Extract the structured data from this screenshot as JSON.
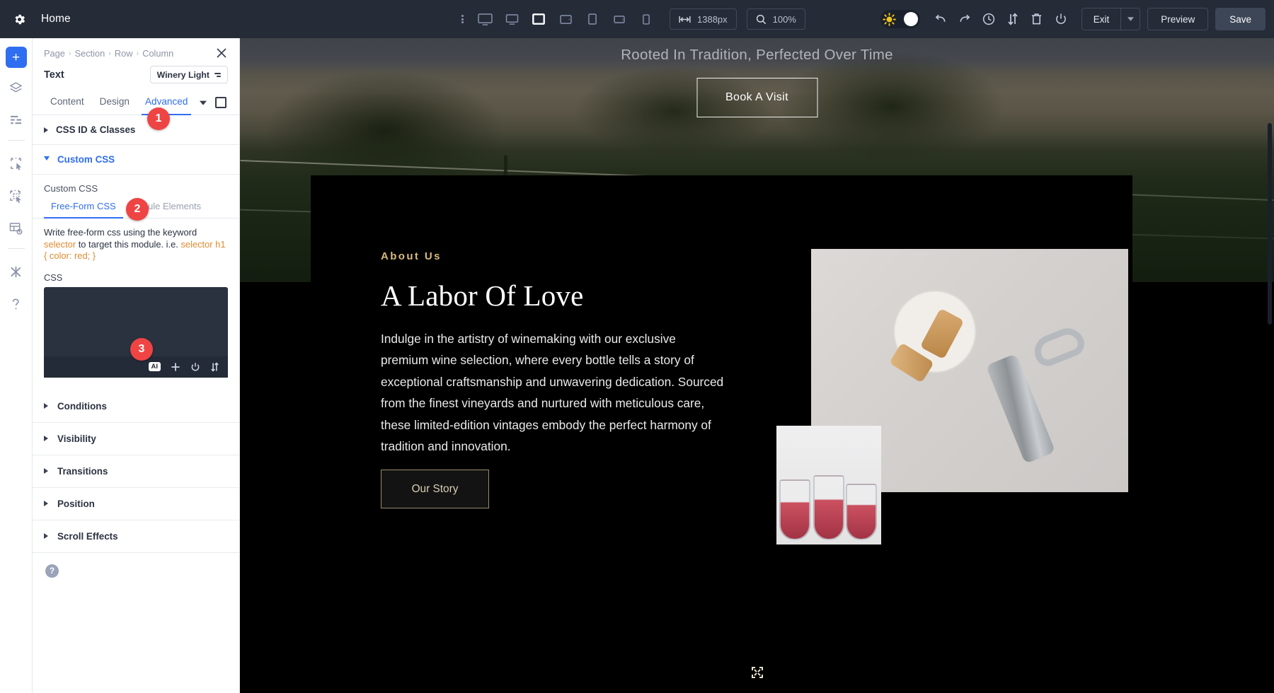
{
  "topbar": {
    "gear_icon": "gear-icon",
    "home_label": "Home",
    "devices": [
      {
        "name": "desktop",
        "icon": "monitor-icon",
        "active": false
      },
      {
        "name": "laptop",
        "icon": "laptop-icon",
        "active": false
      },
      {
        "name": "fullscreen",
        "icon": "square-icon",
        "active": true
      },
      {
        "name": "tablet-landscape",
        "icon": "tablet-landscape-icon",
        "active": false
      },
      {
        "name": "tablet",
        "icon": "tablet-icon",
        "active": false
      },
      {
        "name": "phone-landscape",
        "icon": "phone-landscape-icon",
        "active": false
      },
      {
        "name": "phone",
        "icon": "phone-icon",
        "active": false
      }
    ],
    "width_value": "1388px",
    "zoom_value": "100%",
    "exit_label": "Exit",
    "preview_label": "Preview",
    "save_label": "Save",
    "right_icons": [
      "undo-icon",
      "redo-icon",
      "history-clock-icon",
      "sort-arrows-icon",
      "trash-icon",
      "power-icon"
    ]
  },
  "rail": {
    "items": [
      {
        "name": "add-button",
        "icon": "plus-icon",
        "label": "+"
      },
      {
        "name": "layers",
        "icon": "layers-icon"
      },
      {
        "name": "wireframe",
        "icon": "wireframe-icon"
      },
      {
        "name": "select-module",
        "icon": "select-module-icon"
      },
      {
        "name": "multi-select",
        "icon": "multi-select-icon"
      },
      {
        "name": "history",
        "icon": "history-grid-icon"
      },
      {
        "name": "tools",
        "icon": "tools-icon"
      },
      {
        "name": "help",
        "icon": "question-icon"
      }
    ]
  },
  "panel": {
    "breadcrumb": [
      "Page",
      "Section",
      "Row",
      "Column"
    ],
    "breadcrumb_separator": "›",
    "close_icon": "close-icon",
    "module_title": "Text",
    "preset_label": "Winery Light",
    "tabs": [
      {
        "label": "Content",
        "active": false
      },
      {
        "label": "Design",
        "active": false
      },
      {
        "label": "Advanced",
        "active": true
      }
    ],
    "tab_caret_icon": "chevron-down-icon",
    "tab_square_icon": "square-icon",
    "sections": [
      {
        "label": "CSS ID & Classes",
        "open": false
      },
      {
        "label": "Custom CSS",
        "open": true
      }
    ],
    "custom_css": {
      "field_label": "Custom CSS",
      "subtabs": [
        {
          "label": "Free-Form CSS",
          "active": true
        },
        {
          "label": "Module Elements",
          "active": false
        }
      ],
      "help_part1": "Write free-form css using the keyword ",
      "help_kw1": "selector",
      "help_part2": " to target this module. i.e. ",
      "help_kw2": "selector h1 { color: red; }",
      "css_label": "CSS",
      "editor_value": "",
      "toolbar_icons": [
        "ai-icon",
        "plus-icon",
        "power-icon",
        "sort-arrows-icon"
      ],
      "ai_label": "AI"
    },
    "accordions": [
      {
        "label": "Conditions"
      },
      {
        "label": "Visibility"
      },
      {
        "label": "Transitions"
      },
      {
        "label": "Position"
      },
      {
        "label": "Scroll Effects"
      }
    ],
    "help_icon": "question-circle-icon",
    "steps": [
      {
        "number": "1"
      },
      {
        "number": "2"
      },
      {
        "number": "3"
      }
    ]
  },
  "canvas": {
    "hero": {
      "title": "Rooted In Tradition, Perfected Over Time",
      "button_label": "Book A Visit"
    },
    "about": {
      "eyebrow": "About Us",
      "headline": "A Labor Of Love",
      "body": "Indulge in the artistry of winemaking with our exclusive premium wine selection, where every bottle tells a story of exceptional craftsmanship and unwavering dedication. Sourced from the finest vineyards and nurtured with meticulous care, these limited-edition vintages embody the perfect harmony of tradition and innovation.",
      "button_label": "Our Story",
      "image_cork_name": "cork-and-corkscrew-image",
      "image_glasses_name": "wine-glasses-image"
    },
    "move_icon": "move-resize-icon"
  },
  "colors": {
    "accent_blue": "#2f6ef0",
    "topbar_bg": "#252b37",
    "step_red": "#ef4444",
    "gold": "#d8b97f",
    "editor_bg": "#2a3240"
  }
}
